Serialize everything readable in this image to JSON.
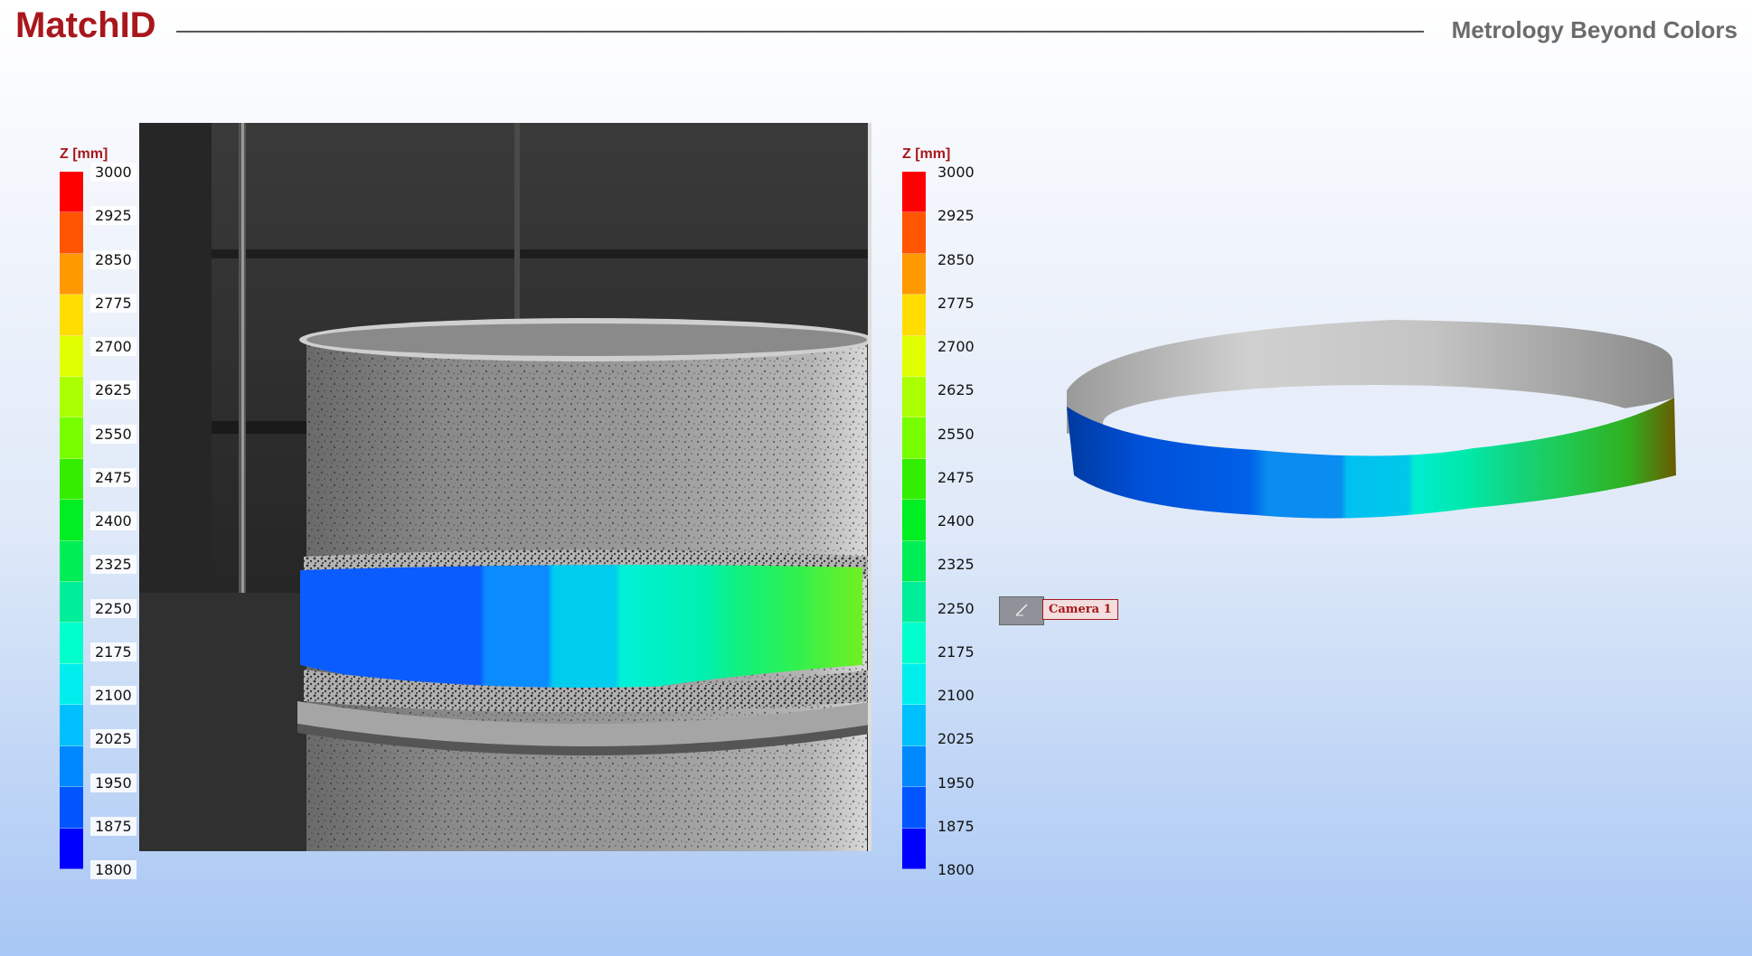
{
  "header": {
    "brand": "MatchID",
    "tagline": "Metrology Beyond Colors"
  },
  "colorbar": {
    "title": "Z [mm]",
    "ticks": [
      "3000",
      "2925",
      "2850",
      "2775",
      "2700",
      "2625",
      "2550",
      "2475",
      "2400",
      "2325",
      "2250",
      "2175",
      "2100",
      "2025",
      "1950",
      "1875",
      "1800"
    ],
    "colors": [
      "#ff0000",
      "#ff5500",
      "#ff9900",
      "#ffdd00",
      "#e0ff00",
      "#aaff00",
      "#77ff00",
      "#33ee00",
      "#00ee22",
      "#00ee55",
      "#00ee99",
      "#00ffcc",
      "#00eeee",
      "#00c0ff",
      "#0088ff",
      "#0055ff",
      "#0000ff"
    ]
  },
  "camera": {
    "label": "Camera 1",
    "icon": "camera-icon"
  }
}
